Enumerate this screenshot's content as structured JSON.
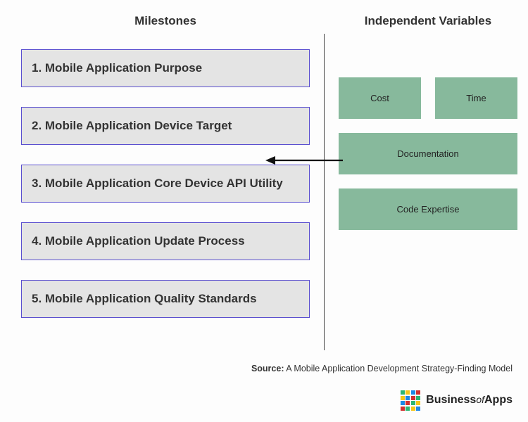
{
  "headings": {
    "left": "Milestones",
    "right": "Independent Variables"
  },
  "milestones": [
    "1. Mobile Application Purpose",
    "2. Mobile Application Device Target",
    "3. Mobile Application Core Device API Utility",
    "4. Mobile Application Update Process",
    "5. Mobile Application Quality Standards"
  ],
  "variables": {
    "row1": [
      "Cost",
      "Time"
    ],
    "row2": "Documentation",
    "row3": "Code Expertise"
  },
  "source": {
    "label": "Source:",
    "text": " A Mobile Application Development Strategy-Finding Model"
  },
  "brand": {
    "pre": "Business",
    "mid": "of",
    "post": "Apps",
    "colors": [
      "#2bb673",
      "#f5c518",
      "#1e88e5",
      "#d32f2f",
      "#f5c518",
      "#1e88e5",
      "#d32f2f",
      "#2bb673",
      "#1e88e5",
      "#d32f2f",
      "#2bb673",
      "#f5c518",
      "#d32f2f",
      "#2bb673",
      "#f5c518",
      "#1e88e5"
    ]
  }
}
